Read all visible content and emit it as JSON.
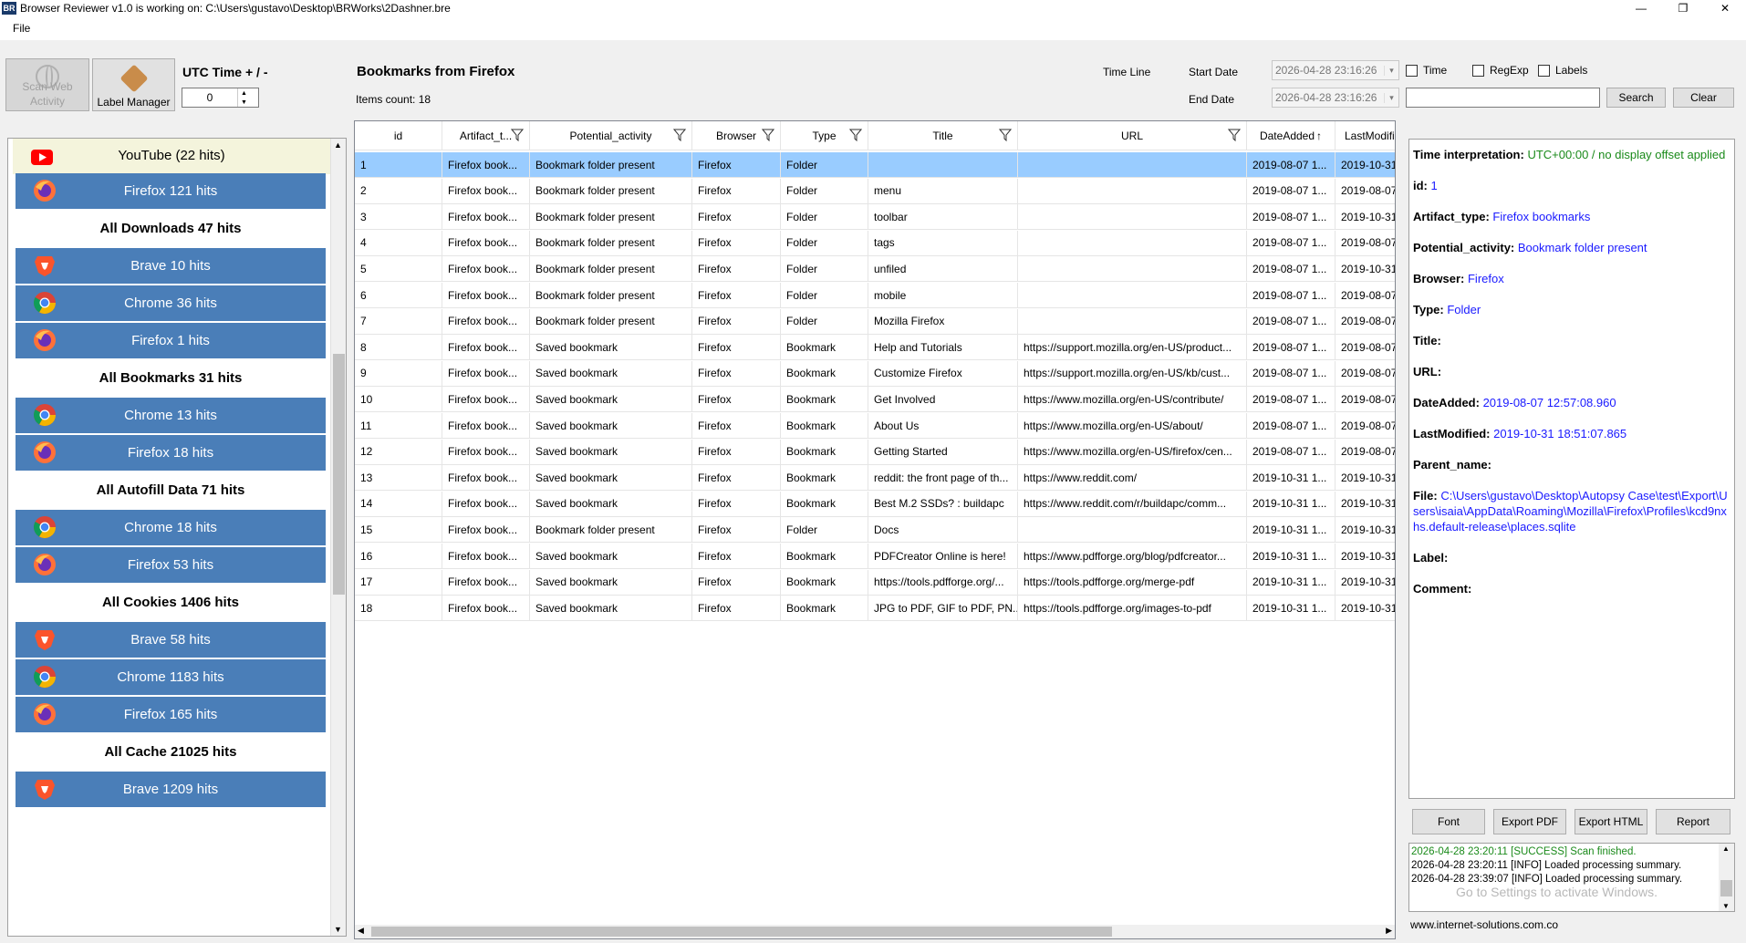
{
  "window": {
    "title": "Browser Reviewer v1.0 is working on:   C:\\Users\\gustavo\\Desktop\\BRWorks\\2Dashner.bre",
    "logo_text": "BR",
    "minimize": "—",
    "maximize": "❐",
    "close": "✕"
  },
  "menu": {
    "file": "File"
  },
  "toolbar": {
    "scan_label": "Scan Web Activity",
    "label_manager": "Label Manager",
    "utc_label": "UTC Time + / -",
    "utc_value": "0",
    "panel_title": "Bookmarks from Firefox",
    "items_count": "Items count: 18",
    "time_line": "Time Line",
    "start_date_label": "Start Date",
    "end_date_label": "End Date",
    "start_date": "2026-04-28 23:16:26",
    "end_date": "2026-04-28 23:16:26",
    "time_cb": "Time",
    "regexp_cb": "RegExp",
    "labels_cb": "Labels",
    "search_btn": "Search",
    "clear_btn": "Clear",
    "search_value": ""
  },
  "left_items": [
    {
      "label": "YouTube (22 hits)",
      "kind": "yt",
      "icon": "youtube-icon"
    },
    {
      "label": "Firefox 121 hits",
      "kind": "blue",
      "icon": "firefox-icon"
    },
    {
      "label": "All Downloads 47 hits",
      "kind": "header",
      "icon": ""
    },
    {
      "label": "Brave 10 hits",
      "kind": "blue",
      "icon": "brave-icon"
    },
    {
      "label": "Chrome 36 hits",
      "kind": "blue",
      "icon": "chrome-icon"
    },
    {
      "label": "Firefox 1 hits",
      "kind": "blue",
      "icon": "firefox-icon"
    },
    {
      "label": "All Bookmarks 31 hits",
      "kind": "header",
      "icon": ""
    },
    {
      "label": "Chrome 13 hits",
      "kind": "blue",
      "icon": "chrome-icon"
    },
    {
      "label": "Firefox 18 hits",
      "kind": "blue",
      "icon": "firefox-icon"
    },
    {
      "label": "All Autofill Data 71 hits",
      "kind": "header",
      "icon": ""
    },
    {
      "label": "Chrome 18 hits",
      "kind": "blue",
      "icon": "chrome-icon"
    },
    {
      "label": "Firefox 53 hits",
      "kind": "blue",
      "icon": "firefox-icon"
    },
    {
      "label": "All Cookies 1406 hits",
      "kind": "header",
      "icon": ""
    },
    {
      "label": "Brave 58 hits",
      "kind": "blue",
      "icon": "brave-icon"
    },
    {
      "label": "Chrome 1183 hits",
      "kind": "blue",
      "icon": "chrome-icon"
    },
    {
      "label": "Firefox 165 hits",
      "kind": "blue",
      "icon": "firefox-icon"
    },
    {
      "label": "All Cache 21025 hits",
      "kind": "header",
      "icon": ""
    },
    {
      "label": "Brave 1209 hits",
      "kind": "blue",
      "icon": "brave-icon"
    }
  ],
  "table": {
    "columns": [
      "id",
      "Artifact_t...",
      "Potential_activity",
      "Browser",
      "Type",
      "Title",
      "URL",
      "DateAdded",
      "LastModifi"
    ],
    "rows": [
      [
        "1",
        "Firefox book...",
        "Bookmark folder present",
        "Firefox",
        "Folder",
        "",
        "",
        "2019-08-07 1...",
        "2019-10-31"
      ],
      [
        "2",
        "Firefox book...",
        "Bookmark folder present",
        "Firefox",
        "Folder",
        "menu",
        "",
        "2019-08-07 1...",
        "2019-08-07"
      ],
      [
        "3",
        "Firefox book...",
        "Bookmark folder present",
        "Firefox",
        "Folder",
        "toolbar",
        "",
        "2019-08-07 1...",
        "2019-10-31"
      ],
      [
        "4",
        "Firefox book...",
        "Bookmark folder present",
        "Firefox",
        "Folder",
        "tags",
        "",
        "2019-08-07 1...",
        "2019-08-07"
      ],
      [
        "5",
        "Firefox book...",
        "Bookmark folder present",
        "Firefox",
        "Folder",
        "unfiled",
        "",
        "2019-08-07 1...",
        "2019-10-31"
      ],
      [
        "6",
        "Firefox book...",
        "Bookmark folder present",
        "Firefox",
        "Folder",
        "mobile",
        "",
        "2019-08-07 1...",
        "2019-08-07"
      ],
      [
        "7",
        "Firefox book...",
        "Bookmark folder present",
        "Firefox",
        "Folder",
        "Mozilla Firefox",
        "",
        "2019-08-07 1...",
        "2019-08-07"
      ],
      [
        "8",
        "Firefox book...",
        "Saved bookmark",
        "Firefox",
        "Bookmark",
        "Help and Tutorials",
        "https://support.mozilla.org/en-US/product...",
        "2019-08-07 1...",
        "2019-08-07"
      ],
      [
        "9",
        "Firefox book...",
        "Saved bookmark",
        "Firefox",
        "Bookmark",
        "Customize Firefox",
        "https://support.mozilla.org/en-US/kb/cust...",
        "2019-08-07 1...",
        "2019-08-07"
      ],
      [
        "10",
        "Firefox book...",
        "Saved bookmark",
        "Firefox",
        "Bookmark",
        "Get Involved",
        "https://www.mozilla.org/en-US/contribute/",
        "2019-08-07 1...",
        "2019-08-07"
      ],
      [
        "11",
        "Firefox book...",
        "Saved bookmark",
        "Firefox",
        "Bookmark",
        "About Us",
        "https://www.mozilla.org/en-US/about/",
        "2019-08-07 1...",
        "2019-08-07"
      ],
      [
        "12",
        "Firefox book...",
        "Saved bookmark",
        "Firefox",
        "Bookmark",
        "Getting Started",
        "https://www.mozilla.org/en-US/firefox/cen...",
        "2019-08-07 1...",
        "2019-08-07"
      ],
      [
        "13",
        "Firefox book...",
        "Saved bookmark",
        "Firefox",
        "Bookmark",
        "reddit: the front page of th...",
        "https://www.reddit.com/",
        "2019-10-31 1...",
        "2019-10-31"
      ],
      [
        "14",
        "Firefox book...",
        "Saved bookmark",
        "Firefox",
        "Bookmark",
        "Best M.2 SSDs? : buildapc",
        "https://www.reddit.com/r/buildapc/comm...",
        "2019-10-31 1...",
        "2019-10-31"
      ],
      [
        "15",
        "Firefox book...",
        "Bookmark folder present",
        "Firefox",
        "Folder",
        "Docs",
        "",
        "2019-10-31 1...",
        "2019-10-31"
      ],
      [
        "16",
        "Firefox book...",
        "Saved bookmark",
        "Firefox",
        "Bookmark",
        "PDFCreator Online is here!",
        "https://www.pdfforge.org/blog/pdfcreator...",
        "2019-10-31 1...",
        "2019-10-31"
      ],
      [
        "17",
        "Firefox book...",
        "Saved bookmark",
        "Firefox",
        "Bookmark",
        "https://tools.pdfforge.org/...",
        "https://tools.pdfforge.org/merge-pdf",
        "2019-10-31 1...",
        "2019-10-31"
      ],
      [
        "18",
        "Firefox book...",
        "Saved bookmark",
        "Firefox",
        "Bookmark",
        "JPG to PDF, GIF to PDF, PN...",
        "https://tools.pdfforge.org/images-to-pdf",
        "2019-10-31 1...",
        "2019-10-31"
      ]
    ]
  },
  "detail": {
    "time_interp_label": "Time interpretation:",
    "time_interp_value": "UTC+00:00 / no display offset applied",
    "id_label": "id:",
    "id_value": "1",
    "artifact_label": "Artifact_type:",
    "artifact_value": "Firefox bookmarks",
    "activity_label": "Potential_activity:",
    "activity_value": "Bookmark folder present",
    "browser_label": "Browser:",
    "browser_value": "Firefox",
    "type_label": "Type:",
    "type_value": "Folder",
    "title_label": "Title:",
    "url_label": "URL:",
    "dateadded_label": "DateAdded:",
    "dateadded_value": "2019-08-07 12:57:08.960",
    "lastmod_label": "LastModified:",
    "lastmod_value": "2019-10-31 18:51:07.865",
    "parent_label": "Parent_name:",
    "file_label": "File:",
    "file_value": "C:\\Users\\gustavo\\Desktop\\Autopsy Case\\test\\Export\\Users\\isaia\\AppData\\Roaming\\Mozilla\\Firefox\\Profiles\\kcd9nxhs.default-release\\places.sqlite",
    "label_label": "Label:",
    "comment_label": "Comment:"
  },
  "actions": {
    "font": "Font",
    "export_pdf": "Export PDF",
    "export_html": "Export HTML",
    "report": "Report"
  },
  "log": [
    {
      "text": "2026-04-28 23:20:11 [SUCCESS] Scan finished.",
      "color": "#1a8a1a"
    },
    {
      "text": "2026-04-28 23:20:11 [INFO] Loaded processing summary.",
      "color": "#000000"
    },
    {
      "text": "2026-04-28 23:39:07 [INFO] Loaded processing summary.",
      "color": "#000000"
    }
  ],
  "watermark": "Go to Settings to activate Windows.",
  "footer": "www.internet-solutions.com.co"
}
